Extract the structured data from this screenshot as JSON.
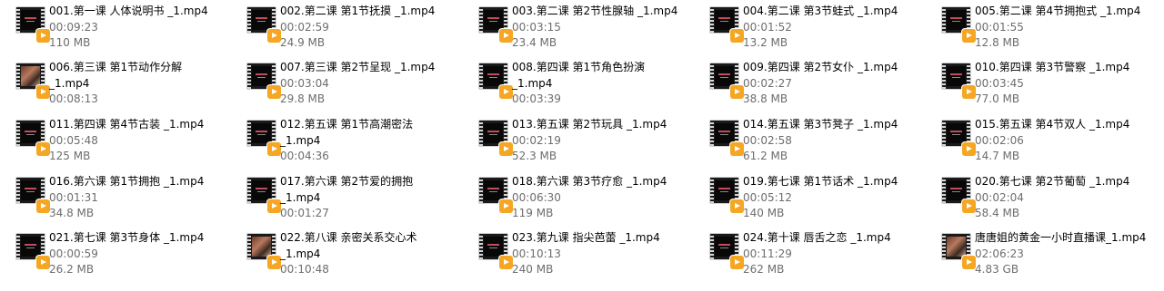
{
  "files": [
    {
      "name": "001.第一课 人体说明书 _1.mp4",
      "name2": "",
      "duration": "00:09:23",
      "size": "110 MB",
      "thumb": "dark"
    },
    {
      "name": "002.第二课 第1节抚摸 _1.mp4",
      "name2": "",
      "duration": "00:02:59",
      "size": "24.9 MB",
      "thumb": "dark"
    },
    {
      "name": "003.第二课 第2节性腺轴 _1.mp4",
      "name2": "",
      "duration": "00:03:15",
      "size": "23.4 MB",
      "thumb": "dark"
    },
    {
      "name": "004.第二课 第3节蛙式 _1.mp4",
      "name2": "",
      "duration": "00:01:52",
      "size": "13.2 MB",
      "thumb": "dark"
    },
    {
      "name": "005.第二课 第4节拥抱式 _1.mp4",
      "name2": "",
      "duration": "00:01:55",
      "size": "12.8 MB",
      "thumb": "dark"
    },
    {
      "name": "006.第三课 第1节动作分解",
      "name2": "_1.mp4",
      "duration": "00:08:13",
      "size": "",
      "thumb": "photo"
    },
    {
      "name": "007.第三课 第2节呈现 _1.mp4",
      "name2": "",
      "duration": "00:03:04",
      "size": "29.8 MB",
      "thumb": "dark"
    },
    {
      "name": "008.第四课 第1节角色扮演",
      "name2": "_1.mp4",
      "duration": "00:03:39",
      "size": "",
      "thumb": "dark"
    },
    {
      "name": "009.第四课 第2节女仆 _1.mp4",
      "name2": "",
      "duration": "00:02:27",
      "size": "38.8 MB",
      "thumb": "dark"
    },
    {
      "name": "010.第四课 第3节警察 _1.mp4",
      "name2": "",
      "duration": "00:03:45",
      "size": "77.0 MB",
      "thumb": "dark"
    },
    {
      "name": "011.第四课 第4节古装 _1.mp4",
      "name2": "",
      "duration": "00:05:48",
      "size": "125 MB",
      "thumb": "dark"
    },
    {
      "name": "012.第五课 第1节高潮密法",
      "name2": "_1.mp4",
      "duration": "00:04:36",
      "size": "",
      "thumb": "dark"
    },
    {
      "name": "013.第五课 第2节玩具 _1.mp4",
      "name2": "",
      "duration": "00:02:19",
      "size": "52.3 MB",
      "thumb": "dark"
    },
    {
      "name": "014.第五课 第3节凳子 _1.mp4",
      "name2": "",
      "duration": "00:02:58",
      "size": "61.2 MB",
      "thumb": "dark"
    },
    {
      "name": "015.第五课 第4节双人 _1.mp4",
      "name2": "",
      "duration": "00:02:06",
      "size": "14.7 MB",
      "thumb": "dark"
    },
    {
      "name": "016.第六课 第1节拥抱 _1.mp4",
      "name2": "",
      "duration": "00:01:31",
      "size": "34.8 MB",
      "thumb": "dark"
    },
    {
      "name": "017.第六课 第2节爱的拥抱",
      "name2": "_1.mp4",
      "duration": "00:01:27",
      "size": "",
      "thumb": "dark"
    },
    {
      "name": "018.第六课 第3节疗愈 _1.mp4",
      "name2": "",
      "duration": "00:06:30",
      "size": "119 MB",
      "thumb": "dark"
    },
    {
      "name": "019.第七课 第1节话术 _1.mp4",
      "name2": "",
      "duration": "00:05:12",
      "size": "140 MB",
      "thumb": "dark"
    },
    {
      "name": "020.第七课 第2节葡萄 _1.mp4",
      "name2": "",
      "duration": "00:02:04",
      "size": "58.4 MB",
      "thumb": "dark"
    },
    {
      "name": "021.第七课 第3节身体 _1.mp4",
      "name2": "",
      "duration": "00:00:59",
      "size": "26.2 MB",
      "thumb": "dark"
    },
    {
      "name": "022.第八课 亲密关系交心术",
      "name2": "_1.mp4",
      "duration": "00:10:48",
      "size": "",
      "thumb": "photo"
    },
    {
      "name": "023.第九课 指尖芭蕾 _1.mp4",
      "name2": "",
      "duration": "00:10:13",
      "size": "240 MB",
      "thumb": "dark"
    },
    {
      "name": "024.第十课 唇舌之恋 _1.mp4",
      "name2": "",
      "duration": "00:11:29",
      "size": "262 MB",
      "thumb": "dark"
    },
    {
      "name": "唐唐姐的黄金一小时直播课_1.mp4",
      "name2": "",
      "duration": "02:06:23",
      "size": "4.83 GB",
      "thumb": "photo"
    }
  ]
}
